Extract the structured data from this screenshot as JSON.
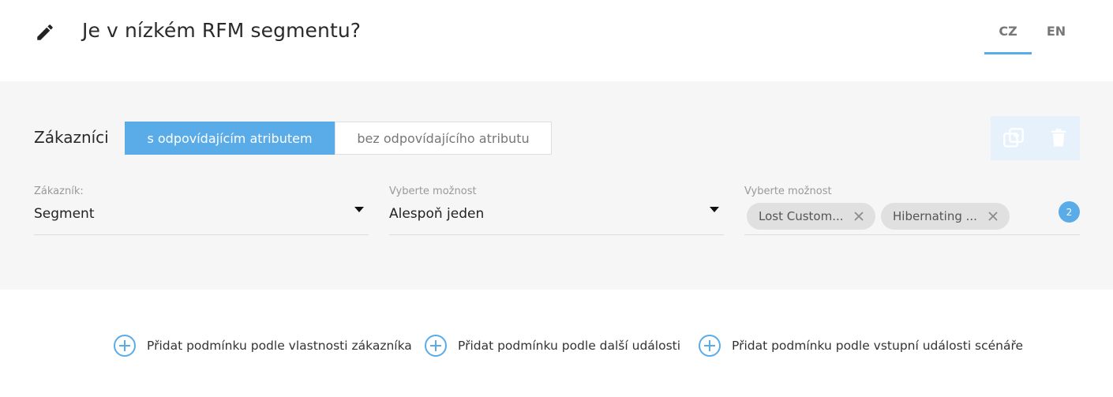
{
  "header": {
    "title": "Je v nízkém RFM segmentu?",
    "languages": [
      {
        "code": "CZ",
        "active": true
      },
      {
        "code": "EN",
        "active": false
      }
    ]
  },
  "condition": {
    "subject_label": "Zákazníci",
    "mode_options": [
      "s odpovídajícím atributem",
      "bez odpovídajícího atributu"
    ],
    "selected_mode": "s odpovídajícím atributem",
    "fields": [
      {
        "label": "Zákazník:",
        "value": "Segment"
      },
      {
        "label": "Vyberte možnost",
        "value": "Alespoň jeden"
      },
      {
        "label": "Vyberte možnost",
        "chips": [
          "Lost Custom...",
          "Hibernating ..."
        ],
        "count": "2"
      }
    ]
  },
  "add_actions": [
    "Přidat podmínku podle vlastnosti zákazníka",
    "Přidat podmínku podle další události",
    "Přidat podmínku podle vstupní události scénáře"
  ],
  "icons": {
    "edit": "pencil-icon",
    "duplicate": "duplicate-icon",
    "delete": "trash-icon",
    "dropdown": "caret-down-icon",
    "remove_chip": "close-icon",
    "add": "plus-circle-icon"
  },
  "colors": {
    "accent": "#5aace9",
    "panel_bg": "#f6f6f6",
    "chip_bg": "#e0e0e0",
    "action_box_bg": "#e6f1fb"
  }
}
